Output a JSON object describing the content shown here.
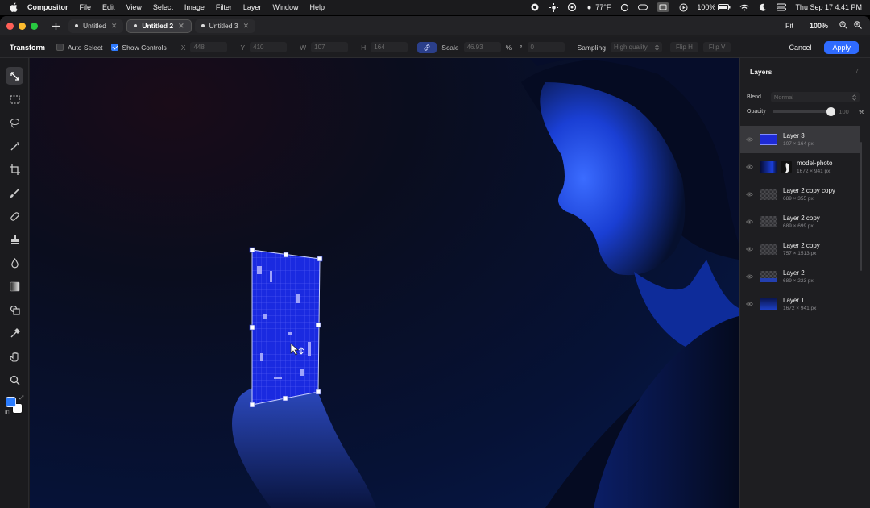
{
  "menubar": {
    "app_name": "Compositor",
    "items": [
      "File",
      "Edit",
      "View",
      "Select",
      "Image",
      "Filter",
      "Layer",
      "Window",
      "Help"
    ],
    "status": {
      "temperature": "77°F",
      "battery": "100%",
      "datetime": "Thu Sep 17  4:41 PM"
    }
  },
  "tabs": [
    {
      "label": "Untitled",
      "active": false
    },
    {
      "label": "Untitled 2",
      "active": true
    },
    {
      "label": "Untitled 3",
      "active": false
    }
  ],
  "view": {
    "fit_label": "Fit",
    "zoom": "100%"
  },
  "options": {
    "tool_title": "Transform",
    "auto_select_label": "Auto Select",
    "show_controls_label": "Show Controls",
    "x_label": "X",
    "x_value": "448",
    "y_label": "Y",
    "y_value": "410",
    "w_label": "W",
    "w_value": "107",
    "h_label": "H",
    "h_value": "164",
    "scale_label": "Scale",
    "scale_value": "46.93",
    "scale_unit": "%",
    "rotation_symbol": "°",
    "rotation_value": "0",
    "sampling_label": "Sampling",
    "sampling_value": "High quality",
    "flip_h": "Flip H",
    "flip_v": "Flip V",
    "cancel": "Cancel",
    "apply": "Apply"
  },
  "layers_panel": {
    "title": "Layers",
    "count": "7",
    "blend_label": "Blend",
    "blend_value": "Normal",
    "opacity_label": "Opacity",
    "opacity_value": "100",
    "opacity_unit": "%",
    "opacity_fraction": 1.0,
    "layers": [
      {
        "name": "Layer 3",
        "dims": "107 × 164 px",
        "selected": true
      },
      {
        "name": "model-photo",
        "dims": "1672 × 941 px",
        "selected": false
      },
      {
        "name": "Layer 2 copy copy",
        "dims": "689 × 355 px",
        "selected": false
      },
      {
        "name": "Layer 2 copy",
        "dims": "689 × 699 px",
        "selected": false
      },
      {
        "name": "Layer 2 copy",
        "dims": "757 × 1513 px",
        "selected": false
      },
      {
        "name": "Layer 2",
        "dims": "689 × 223 px",
        "selected": false
      },
      {
        "name": "Layer 1",
        "dims": "1672 × 941 px",
        "selected": false
      }
    ]
  },
  "colors": {
    "accent": "#2f6bff",
    "foreground_swatch": "#2a7cff",
    "background_swatch": "#ffffff"
  }
}
